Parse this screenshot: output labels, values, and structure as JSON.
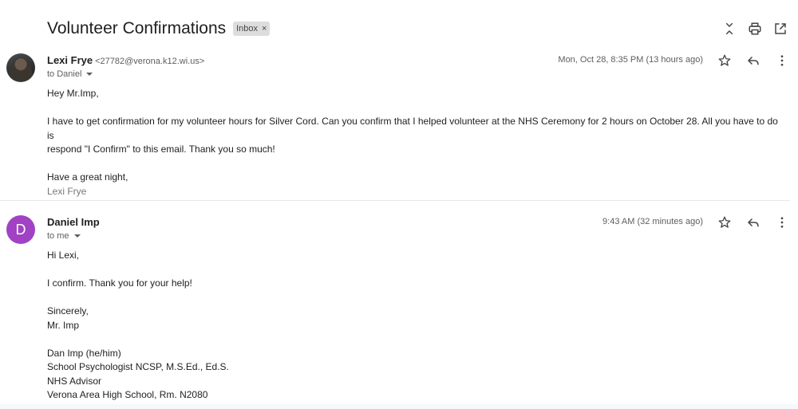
{
  "thread": {
    "subject": "Volunteer Confirmations",
    "label": "Inbox",
    "label_remove": "×"
  },
  "messages": [
    {
      "sender_name": "Lexi Frye",
      "sender_email": "<27782@verona.k12.wi.us>",
      "recipient": "to Daniel",
      "date": "Mon, Oct 28, 8:35 PM (13 hours ago)",
      "greeting": "Hey Mr.Imp,",
      "body_line_1": "I have to get confirmation for my volunteer hours for Silver Cord. Can you confirm that I helped volunteer at the NHS Ceremony for 2 hours on October 28. All you have to do is",
      "body_line_2": "respond \"I Confirm\" to this email. Thank you so much!",
      "closing": "Have a great night,",
      "signature": "Lexi Frye"
    },
    {
      "avatar_letter": "D",
      "sender_name": "Daniel Imp",
      "recipient": "to me",
      "date": "9:43 AM (32 minutes ago)",
      "greeting": "Hi Lexi,",
      "body": "I confirm. Thank you for your help!",
      "closing": "Sincerely,",
      "closing_name": "Mr. Imp",
      "sig_1": "Dan Imp (he/him)",
      "sig_2": "School Psychologist NCSP, M.S.Ed., Ed.S.",
      "sig_3": "NHS Advisor",
      "sig_4": "Verona Area High School, Rm. N2080"
    }
  ],
  "icons": [
    "collapse-all-icon",
    "print-icon",
    "open-new-window-icon",
    "star-icon",
    "reply-icon",
    "more-vert-icon"
  ]
}
